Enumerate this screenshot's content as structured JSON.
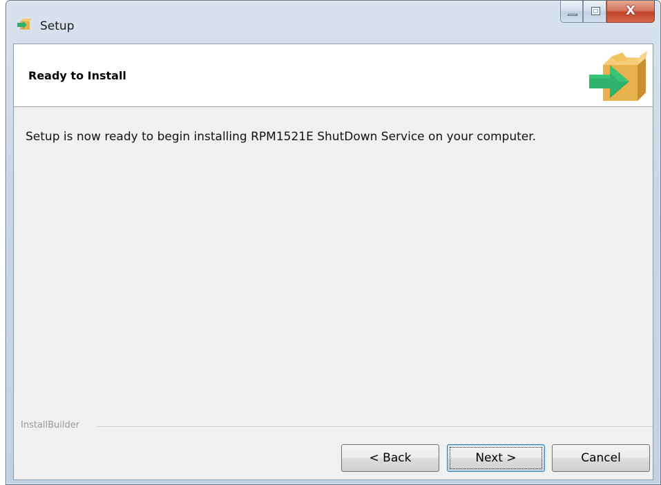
{
  "window": {
    "title": "Setup",
    "icons": {
      "app": "setup-box-icon",
      "minimize": "minimize-icon",
      "maximize": "maximize-icon",
      "close": "close-icon"
    },
    "close_glyph": "X"
  },
  "header": {
    "title": "Ready to Install",
    "logo": "install-box-arrow-icon"
  },
  "body": {
    "message": "Setup is now ready to begin installing RPM1521E ShutDown Service on your computer."
  },
  "footer": {
    "brand": "InstallBuilder",
    "buttons": {
      "back": "< Back",
      "next": "Next >",
      "cancel": "Cancel"
    }
  },
  "colors": {
    "arrow": "#2fb36a",
    "box": "#e7b24e",
    "close_button": "#c2432a"
  }
}
